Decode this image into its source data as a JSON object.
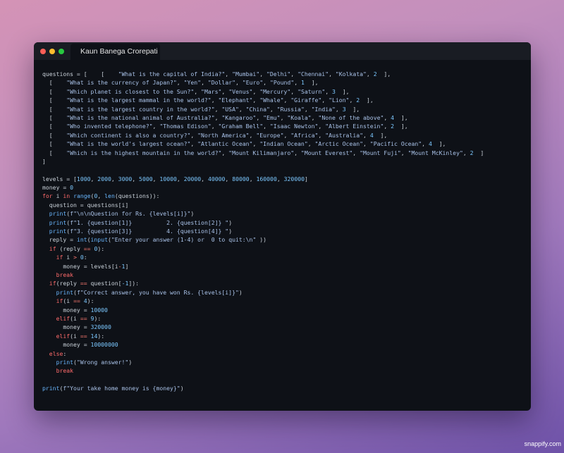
{
  "window": {
    "tab_title": "Kaun Banega Crorepati"
  },
  "code_lines": [
    [
      {
        "t": "questions = [    [    "
      },
      {
        "t": "\"What is the capital of India?\"",
        "c": "str"
      },
      {
        "t": ", "
      },
      {
        "t": "\"Mumbai\"",
        "c": "str"
      },
      {
        "t": ", "
      },
      {
        "t": "\"Delhi\"",
        "c": "str"
      },
      {
        "t": ", "
      },
      {
        "t": "\"Chennai\"",
        "c": "str"
      },
      {
        "t": ", "
      },
      {
        "t": "\"Kolkata\"",
        "c": "str"
      },
      {
        "t": ", "
      },
      {
        "t": "2",
        "c": "num"
      },
      {
        "t": "  ],"
      }
    ],
    [
      {
        "t": "  [    "
      },
      {
        "t": "\"What is the currency of Japan?\"",
        "c": "str"
      },
      {
        "t": ", "
      },
      {
        "t": "\"Yen\"",
        "c": "str"
      },
      {
        "t": ", "
      },
      {
        "t": "\"Dollar\"",
        "c": "str"
      },
      {
        "t": ", "
      },
      {
        "t": "\"Euro\"",
        "c": "str"
      },
      {
        "t": ", "
      },
      {
        "t": "\"Pound\"",
        "c": "str"
      },
      {
        "t": ", "
      },
      {
        "t": "1",
        "c": "num"
      },
      {
        "t": "  ],"
      }
    ],
    [
      {
        "t": "  [    "
      },
      {
        "t": "\"Which planet is closest to the Sun?\"",
        "c": "str"
      },
      {
        "t": ", "
      },
      {
        "t": "\"Mars\"",
        "c": "str"
      },
      {
        "t": ", "
      },
      {
        "t": "\"Venus\"",
        "c": "str"
      },
      {
        "t": ", "
      },
      {
        "t": "\"Mercury\"",
        "c": "str"
      },
      {
        "t": ", "
      },
      {
        "t": "\"Saturn\"",
        "c": "str"
      },
      {
        "t": ", "
      },
      {
        "t": "3",
        "c": "num"
      },
      {
        "t": "  ],"
      }
    ],
    [
      {
        "t": "  [    "
      },
      {
        "t": "\"What is the largest mammal in the world?\"",
        "c": "str"
      },
      {
        "t": ", "
      },
      {
        "t": "\"Elephant\"",
        "c": "str"
      },
      {
        "t": ", "
      },
      {
        "t": "\"Whale\"",
        "c": "str"
      },
      {
        "t": ", "
      },
      {
        "t": "\"Giraffe\"",
        "c": "str"
      },
      {
        "t": ", "
      },
      {
        "t": "\"Lion\"",
        "c": "str"
      },
      {
        "t": ", "
      },
      {
        "t": "2",
        "c": "num"
      },
      {
        "t": "  ],"
      }
    ],
    [
      {
        "t": "  [    "
      },
      {
        "t": "\"What is the largest country in the world?\"",
        "c": "str"
      },
      {
        "t": ", "
      },
      {
        "t": "\"USA\"",
        "c": "str"
      },
      {
        "t": ", "
      },
      {
        "t": "\"China\"",
        "c": "str"
      },
      {
        "t": ", "
      },
      {
        "t": "\"Russia\"",
        "c": "str"
      },
      {
        "t": ", "
      },
      {
        "t": "\"India\"",
        "c": "str"
      },
      {
        "t": ", "
      },
      {
        "t": "3",
        "c": "num"
      },
      {
        "t": "  ],"
      }
    ],
    [
      {
        "t": "  [    "
      },
      {
        "t": "\"What is the national animal of Australia?\"",
        "c": "str"
      },
      {
        "t": ", "
      },
      {
        "t": "\"Kangaroo\"",
        "c": "str"
      },
      {
        "t": ", "
      },
      {
        "t": "\"Emu\"",
        "c": "str"
      },
      {
        "t": ", "
      },
      {
        "t": "\"Koala\"",
        "c": "str"
      },
      {
        "t": ", "
      },
      {
        "t": "\"None of the above\"",
        "c": "str"
      },
      {
        "t": ", "
      },
      {
        "t": "4",
        "c": "num"
      },
      {
        "t": "  ],"
      }
    ],
    [
      {
        "t": "  [    "
      },
      {
        "t": "\"Who invented telephone?\"",
        "c": "str"
      },
      {
        "t": ", "
      },
      {
        "t": "\"Thomas Edison\"",
        "c": "str"
      },
      {
        "t": ", "
      },
      {
        "t": "\"Graham Bell\"",
        "c": "str"
      },
      {
        "t": ", "
      },
      {
        "t": "\"Isaac Newton\"",
        "c": "str"
      },
      {
        "t": ", "
      },
      {
        "t": "\"Albert Einstein\"",
        "c": "str"
      },
      {
        "t": ", "
      },
      {
        "t": "2",
        "c": "num"
      },
      {
        "t": "  ],"
      }
    ],
    [
      {
        "t": "  [    "
      },
      {
        "t": "\"Which continent is also a country?\"",
        "c": "str"
      },
      {
        "t": ", "
      },
      {
        "t": "\"North America\"",
        "c": "str"
      },
      {
        "t": ", "
      },
      {
        "t": "\"Europe\"",
        "c": "str"
      },
      {
        "t": ", "
      },
      {
        "t": "\"Africa\"",
        "c": "str"
      },
      {
        "t": ", "
      },
      {
        "t": "\"Australia\"",
        "c": "str"
      },
      {
        "t": ", "
      },
      {
        "t": "4",
        "c": "num"
      },
      {
        "t": "  ],"
      }
    ],
    [
      {
        "t": "  [    "
      },
      {
        "t": "\"What is the world's largest ocean?\"",
        "c": "str"
      },
      {
        "t": ", "
      },
      {
        "t": "\"Atlantic Ocean\"",
        "c": "str"
      },
      {
        "t": ", "
      },
      {
        "t": "\"Indian Ocean\"",
        "c": "str"
      },
      {
        "t": ", "
      },
      {
        "t": "\"Arctic Ocean\"",
        "c": "str"
      },
      {
        "t": ", "
      },
      {
        "t": "\"Pacific Ocean\"",
        "c": "str"
      },
      {
        "t": ", "
      },
      {
        "t": "4",
        "c": "num"
      },
      {
        "t": "  ],"
      }
    ],
    [
      {
        "t": "  [    "
      },
      {
        "t": "\"Which is the highest mountain in the world?\"",
        "c": "str"
      },
      {
        "t": ", "
      },
      {
        "t": "\"Mount Kilimanjaro\"",
        "c": "str"
      },
      {
        "t": ", "
      },
      {
        "t": "\"Mount Everest\"",
        "c": "str"
      },
      {
        "t": ", "
      },
      {
        "t": "\"Mount Fuji\"",
        "c": "str"
      },
      {
        "t": ", "
      },
      {
        "t": "\"Mount McKinley\"",
        "c": "str"
      },
      {
        "t": ", "
      },
      {
        "t": "2",
        "c": "num"
      },
      {
        "t": "  ]"
      }
    ],
    [
      {
        "t": "]"
      }
    ],
    [
      {
        "t": ""
      }
    ],
    [
      {
        "t": "levels = ["
      },
      {
        "t": "1000",
        "c": "num"
      },
      {
        "t": ", "
      },
      {
        "t": "2000",
        "c": "num"
      },
      {
        "t": ", "
      },
      {
        "t": "3000",
        "c": "num"
      },
      {
        "t": ", "
      },
      {
        "t": "5000",
        "c": "num"
      },
      {
        "t": ", "
      },
      {
        "t": "10000",
        "c": "num"
      },
      {
        "t": ", "
      },
      {
        "t": "20000",
        "c": "num"
      },
      {
        "t": ", "
      },
      {
        "t": "40000",
        "c": "num"
      },
      {
        "t": ", "
      },
      {
        "t": "80000",
        "c": "num"
      },
      {
        "t": ", "
      },
      {
        "t": "160000",
        "c": "num"
      },
      {
        "t": ", "
      },
      {
        "t": "320000",
        "c": "num"
      },
      {
        "t": "]"
      }
    ],
    [
      {
        "t": "money = "
      },
      {
        "t": "0",
        "c": "num"
      }
    ],
    [
      {
        "t": "for",
        "c": "kw"
      },
      {
        "t": " i "
      },
      {
        "t": "in",
        "c": "kw"
      },
      {
        "t": " "
      },
      {
        "t": "range",
        "c": "fn"
      },
      {
        "t": "("
      },
      {
        "t": "0",
        "c": "num"
      },
      {
        "t": ", "
      },
      {
        "t": "len",
        "c": "fn"
      },
      {
        "t": "(questions)):"
      }
    ],
    [
      {
        "t": "  question = questions[i]"
      }
    ],
    [
      {
        "t": "  "
      },
      {
        "t": "print",
        "c": "fn"
      },
      {
        "t": "("
      },
      {
        "t": "f\"\\n\\nQuestion for Rs. {levels[i]}\"",
        "c": "str"
      },
      {
        "t": ")"
      }
    ],
    [
      {
        "t": "  "
      },
      {
        "t": "print",
        "c": "fn"
      },
      {
        "t": "("
      },
      {
        "t": "f\"1. {question[1]}          2. {question[2]} \"",
        "c": "str"
      },
      {
        "t": ")"
      }
    ],
    [
      {
        "t": "  "
      },
      {
        "t": "print",
        "c": "fn"
      },
      {
        "t": "("
      },
      {
        "t": "f\"3. {question[3]}          4. {question[4]} \"",
        "c": "str"
      },
      {
        "t": ")"
      }
    ],
    [
      {
        "t": "  reply = "
      },
      {
        "t": "int",
        "c": "fn"
      },
      {
        "t": "("
      },
      {
        "t": "input",
        "c": "fn"
      },
      {
        "t": "("
      },
      {
        "t": "\"Enter your answer (1-4) or  0 to quit:\\n\"",
        "c": "str"
      },
      {
        "t": " ))"
      }
    ],
    [
      {
        "t": "  "
      },
      {
        "t": "if",
        "c": "kw"
      },
      {
        "t": " (reply "
      },
      {
        "t": "==",
        "c": "op"
      },
      {
        "t": " "
      },
      {
        "t": "0",
        "c": "num"
      },
      {
        "t": "):"
      }
    ],
    [
      {
        "t": "    "
      },
      {
        "t": "if",
        "c": "kw"
      },
      {
        "t": " i "
      },
      {
        "t": ">",
        "c": "op"
      },
      {
        "t": " "
      },
      {
        "t": "0",
        "c": "num"
      },
      {
        "t": ":"
      }
    ],
    [
      {
        "t": "      money = levels[i"
      },
      {
        "t": "-",
        "c": "op"
      },
      {
        "t": "1",
        "c": "num"
      },
      {
        "t": "]"
      }
    ],
    [
      {
        "t": "    "
      },
      {
        "t": "break",
        "c": "kw"
      }
    ],
    [
      {
        "t": "  "
      },
      {
        "t": "if",
        "c": "kw"
      },
      {
        "t": "(reply "
      },
      {
        "t": "==",
        "c": "op"
      },
      {
        "t": " question["
      },
      {
        "t": "-1",
        "c": "num"
      },
      {
        "t": "]):"
      }
    ],
    [
      {
        "t": "    "
      },
      {
        "t": "print",
        "c": "fn"
      },
      {
        "t": "("
      },
      {
        "t": "f\"Correct answer, you have won Rs. {levels[i]}\"",
        "c": "str"
      },
      {
        "t": ")"
      }
    ],
    [
      {
        "t": "    "
      },
      {
        "t": "if",
        "c": "kw"
      },
      {
        "t": "(i "
      },
      {
        "t": "==",
        "c": "op"
      },
      {
        "t": " "
      },
      {
        "t": "4",
        "c": "num"
      },
      {
        "t": "):"
      }
    ],
    [
      {
        "t": "      money = "
      },
      {
        "t": "10000",
        "c": "num"
      }
    ],
    [
      {
        "t": "    "
      },
      {
        "t": "elif",
        "c": "kw"
      },
      {
        "t": "(i "
      },
      {
        "t": "==",
        "c": "op"
      },
      {
        "t": " "
      },
      {
        "t": "9",
        "c": "num"
      },
      {
        "t": "):"
      }
    ],
    [
      {
        "t": "      money = "
      },
      {
        "t": "320000",
        "c": "num"
      }
    ],
    [
      {
        "t": "    "
      },
      {
        "t": "elif",
        "c": "kw"
      },
      {
        "t": "(i "
      },
      {
        "t": "==",
        "c": "op"
      },
      {
        "t": " "
      },
      {
        "t": "14",
        "c": "num"
      },
      {
        "t": "):"
      }
    ],
    [
      {
        "t": "      money = "
      },
      {
        "t": "10000000",
        "c": "num"
      }
    ],
    [
      {
        "t": "  "
      },
      {
        "t": "else",
        "c": "kw"
      },
      {
        "t": ":"
      }
    ],
    [
      {
        "t": "    "
      },
      {
        "t": "print",
        "c": "fn"
      },
      {
        "t": "("
      },
      {
        "t": "\"Wrong answer!\"",
        "c": "str"
      },
      {
        "t": ")"
      }
    ],
    [
      {
        "t": "    "
      },
      {
        "t": "break",
        "c": "kw"
      }
    ],
    [
      {
        "t": ""
      }
    ],
    [
      {
        "t": "print",
        "c": "fn"
      },
      {
        "t": "("
      },
      {
        "t": "f\"Your take home money is {money}\"",
        "c": "str"
      },
      {
        "t": ")"
      }
    ]
  ],
  "watermark": "snappify.com"
}
